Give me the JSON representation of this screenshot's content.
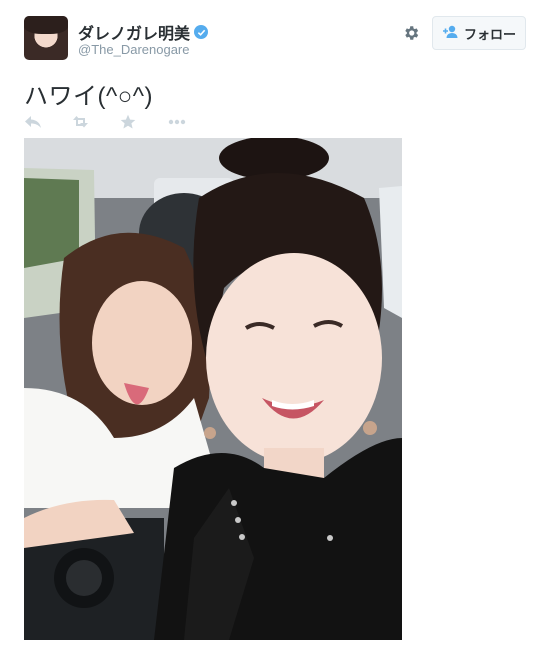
{
  "user": {
    "display_name": "ダレノガレ明美",
    "handle": "@The_Darenogare",
    "verified": true
  },
  "follow_button": {
    "label": "フォロー",
    "icon": "follow-person-icon"
  },
  "settings_icon": "gear-icon",
  "tweet": {
    "text": "ハワイ(^○^)"
  },
  "actions": [
    {
      "name": "reply-icon"
    },
    {
      "name": "retweet-icon"
    },
    {
      "name": "favorite-icon"
    },
    {
      "name": "more-icon"
    }
  ],
  "photo": {
    "description_icon": "photo-image"
  },
  "colors": {
    "accent": "#55acee",
    "text": "#292f33",
    "muted": "#8899a6",
    "action_gray": "#ccd6dd"
  }
}
